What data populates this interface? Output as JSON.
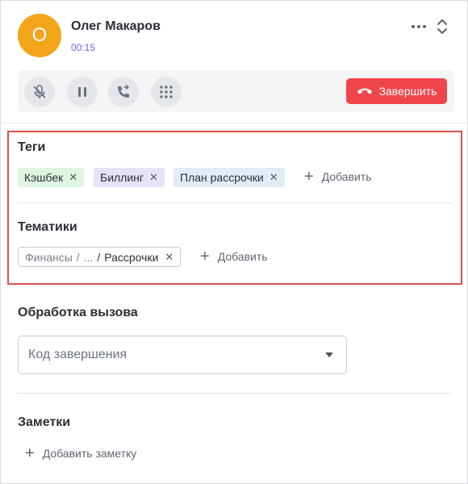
{
  "caller": {
    "initial": "О",
    "name": "Олег Макаров",
    "timer": "00:15"
  },
  "controls": {
    "end_label": "Завершить",
    "icons": [
      "mic-off-icon",
      "pause-icon",
      "transfer-icon",
      "keypad-icon",
      "hangup-icon"
    ]
  },
  "tags": {
    "title": "Теги",
    "items": [
      {
        "label": "Кэшбек",
        "color": "#dff4e1"
      },
      {
        "label": "Биллинг",
        "color": "#e6e2f7"
      },
      {
        "label": "План рассрочки",
        "color": "#e3ebf8"
      }
    ],
    "add_label": "Добавить"
  },
  "topics": {
    "title": "Тематики",
    "chip": {
      "root": "Финансы",
      "sep1": "/",
      "ellipsis": "...",
      "sep2": "/",
      "leaf": "Рассрочки"
    },
    "add_label": "Добавить"
  },
  "processing": {
    "title": "Обработка вызова",
    "select_placeholder": "Код завершения"
  },
  "notes": {
    "title": "Заметки",
    "add_label": "Добавить заметку"
  },
  "colors": {
    "accent": "#7b5ff0",
    "avatar": "#f2a51a",
    "danger": "#f0454b",
    "highlight": "#d9534f"
  }
}
